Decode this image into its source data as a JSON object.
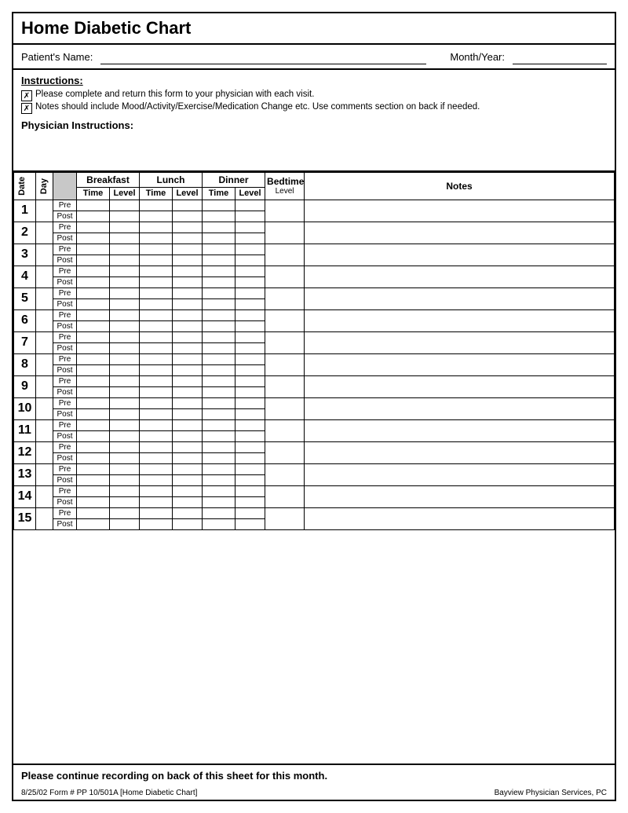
{
  "title": "Home Diabetic Chart",
  "patient_label": "Patient's Name:",
  "month_label": "Month/Year:",
  "instructions": {
    "title": "Instructions:",
    "lines": [
      "Please complete and return this form to your physician with each visit.",
      "Notes should include Mood/Activity/Exercise/Medication Change etc.  Use comments section on back if needed."
    ],
    "physician_label": "Physician Instructions:"
  },
  "table": {
    "headers": {
      "date": "Date",
      "day": "Day",
      "breakfast": "Breakfast",
      "lunch": "Lunch",
      "dinner": "Dinner",
      "bedtime": "Bedtime",
      "notes": "Notes"
    },
    "subheaders": {
      "time": "Time",
      "level": "Level"
    },
    "pre": "Pre",
    "post": "Post",
    "rows": [
      1,
      2,
      3,
      4,
      5,
      6,
      7,
      8,
      9,
      10,
      11,
      12,
      13,
      14,
      15
    ]
  },
  "footer": {
    "continue_text": "Please continue recording on back of this sheet for this month.",
    "left_info": "8/25/02  Form #  PP 10/501A   [Home Diabetic Chart]",
    "right_info": "Bayview Physician Services, PC"
  }
}
